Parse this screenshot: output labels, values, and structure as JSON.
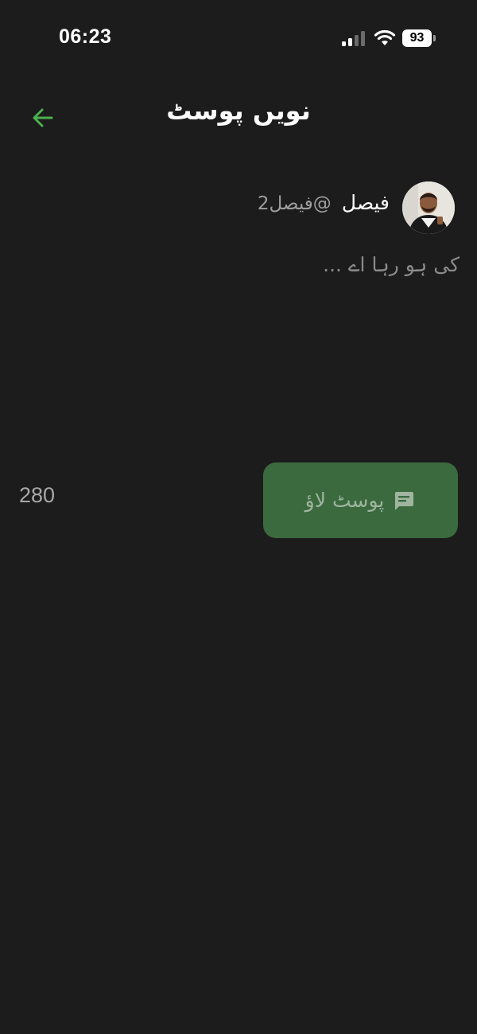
{
  "status_bar": {
    "time": "06:23",
    "battery": "93",
    "signal_icon": "cellular-signal-icon",
    "wifi_icon": "wifi-icon",
    "battery_icon": "battery-icon"
  },
  "header": {
    "title": "نویں پوسٹ",
    "back_icon": "arrow-left-icon",
    "accent_color": "#4caf50"
  },
  "author": {
    "name": "فیصل",
    "handle": "@فیصل2",
    "avatar_icon": "avatar-photo"
  },
  "composer": {
    "placeholder": "کی ہو رہا اے ...",
    "value": ""
  },
  "actions": {
    "char_count": "280",
    "post_label": "پوسٹ لاؤ",
    "post_icon": "message-icon",
    "post_button_color": "#3a6a3d"
  }
}
